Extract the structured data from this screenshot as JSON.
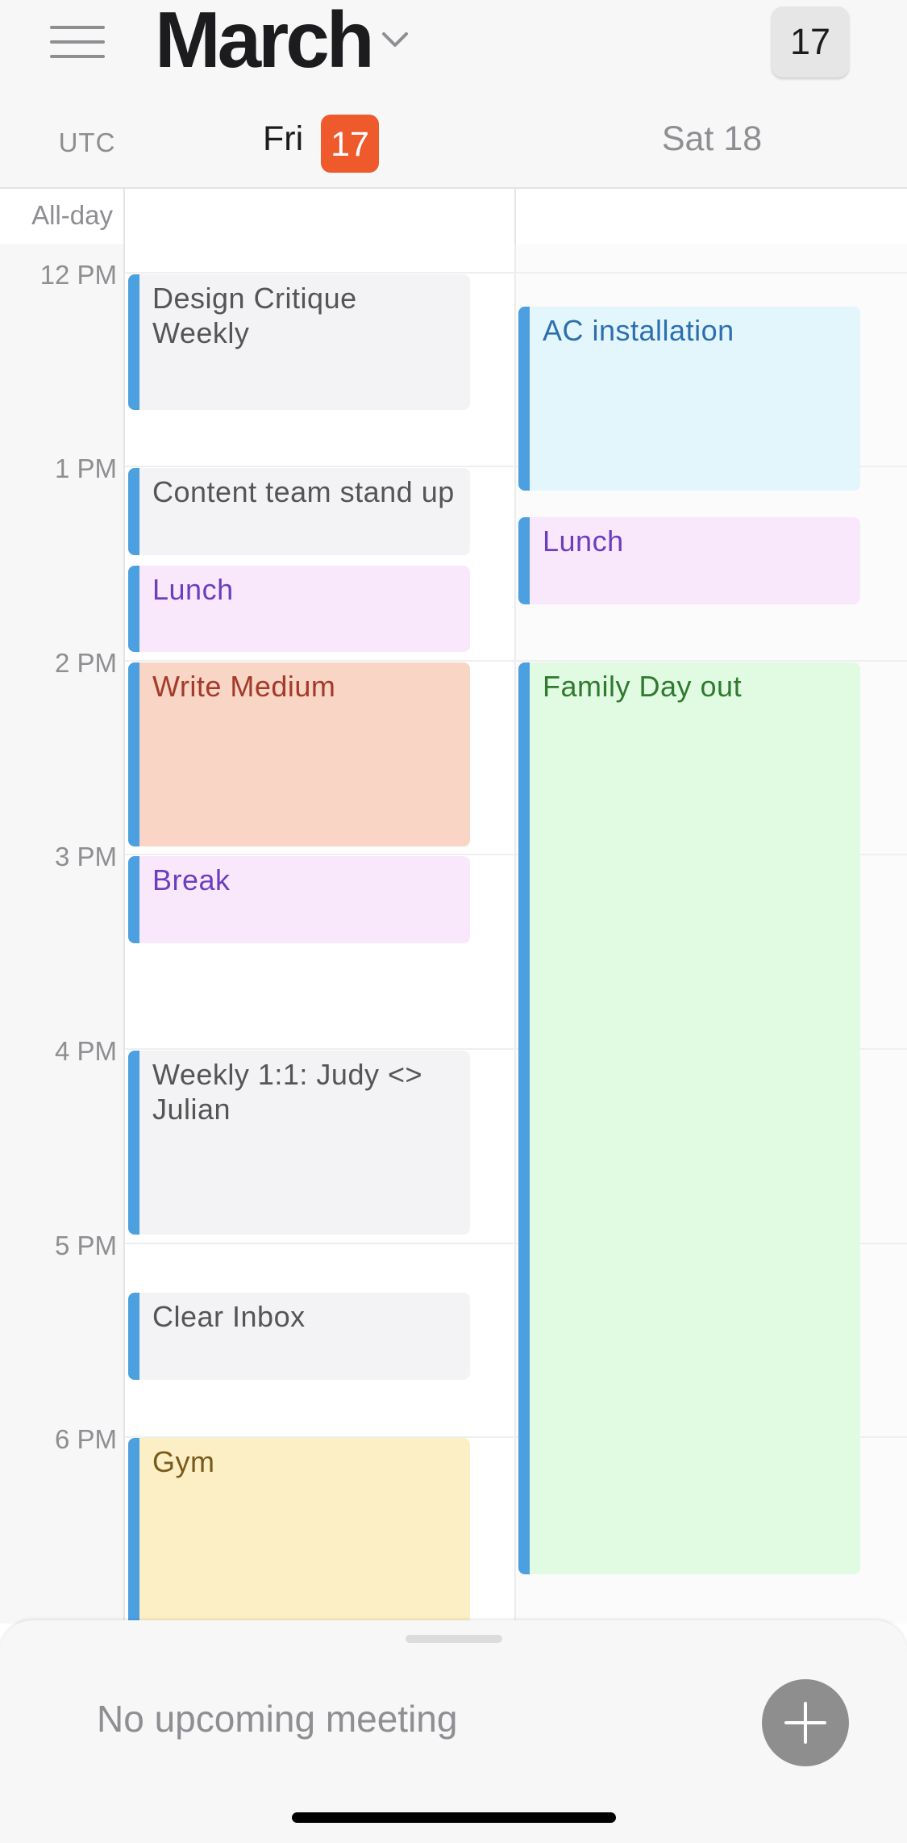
{
  "header": {
    "month": "March",
    "today_button": "17",
    "timezone": "UTC",
    "days": [
      {
        "weekday": "Fri",
        "date": "17",
        "is_today": true
      },
      {
        "label": "Sat 18",
        "is_today": false
      }
    ],
    "allday_label": "All-day"
  },
  "time_labels": [
    "12 PM",
    "1 PM",
    "2 PM",
    "3 PM",
    "4 PM",
    "5 PM",
    "6 PM"
  ],
  "events": {
    "fri": [
      {
        "title": "Design Critique Weekly",
        "color": "#f3f2f4",
        "text_color": "#555555"
      },
      {
        "title": "Content team stand up",
        "color": "#f3f2f4",
        "text_color": "#555555"
      },
      {
        "title": "Lunch",
        "color": "#f9e8fb",
        "text_color": "#6a3fbf"
      },
      {
        "title": "Write Medium",
        "color": "#f8d5c4",
        "text_color": "#a33a2a"
      },
      {
        "title": "Break",
        "color": "#f9e8fb",
        "text_color": "#6a3fbf"
      },
      {
        "title": "Weekly 1:1: Judy <> Julian",
        "color": "#f3f2f4",
        "text_color": "#555555"
      },
      {
        "title": "Clear Inbox",
        "color": "#f3f2f4",
        "text_color": "#555555"
      },
      {
        "title": "Gym",
        "color": "#fcefc5",
        "text_color": "#7a5a1a"
      }
    ],
    "sat": [
      {
        "title": "AC installation",
        "color": "#e3f6fc",
        "text_color": "#2c6fb0"
      },
      {
        "title": "Lunch",
        "color": "#f9e8fb",
        "text_color": "#6a3fbf"
      },
      {
        "title": "Family Day out",
        "color": "#e1fbe2",
        "text_color": "#2f7a2f"
      }
    ]
  },
  "bottom_sheet": {
    "status_text": "No upcoming meeting",
    "add_icon": "plus-icon"
  },
  "colors": {
    "accent": "#ee5a2b",
    "event_bar": "#4da0e0"
  }
}
